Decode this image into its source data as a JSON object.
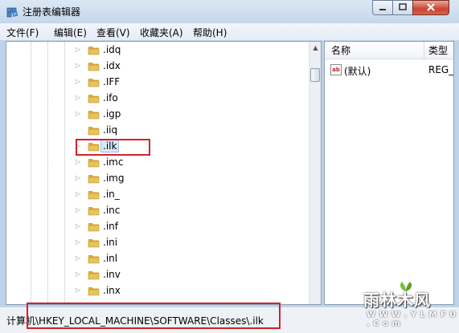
{
  "window": {
    "title": "注册表编辑器",
    "app_icon": "regedit-icon",
    "buttons": {
      "minimize": "─",
      "maximize": "□",
      "close": "✕"
    }
  },
  "menubar": {
    "items": [
      "文件(F)",
      "编辑(E)",
      "查看(V)",
      "收藏夹(A)",
      "帮助(H)"
    ]
  },
  "tree": {
    "items": [
      {
        "label": ".idq",
        "expandable": true
      },
      {
        "label": ".idx",
        "expandable": true
      },
      {
        "label": ".IFF",
        "expandable": true
      },
      {
        "label": ".ifo",
        "expandable": true
      },
      {
        "label": ".igp",
        "expandable": true
      },
      {
        "label": ".iiq",
        "expandable": false
      },
      {
        "label": ".ilk",
        "expandable": true,
        "selected": true
      },
      {
        "label": ".imc",
        "expandable": true
      },
      {
        "label": ".img",
        "expandable": true
      },
      {
        "label": ".in_",
        "expandable": true
      },
      {
        "label": ".inc",
        "expandable": true
      },
      {
        "label": ".inf",
        "expandable": true
      },
      {
        "label": ".ini",
        "expandable": true
      },
      {
        "label": ".inl",
        "expandable": true
      },
      {
        "label": ".inv",
        "expandable": true
      },
      {
        "label": ".inx",
        "expandable": true
      }
    ],
    "selected_index": 6
  },
  "values": {
    "columns": {
      "name": "名称",
      "type": "类型"
    },
    "rows": [
      {
        "name": "(默认)",
        "type": "REG_",
        "icon": "string-value-icon"
      }
    ]
  },
  "statusbar": {
    "path": "计算机\\HKEY_LOCAL_MACHINE\\SOFTWARE\\Classes\\.ilk"
  },
  "watermark": {
    "name": "雨林木风",
    "url": "W W W . Y L M F U . C o m"
  },
  "colors": {
    "highlight_box": "#d2232a",
    "selection": "#d9e8fb",
    "folder": "#e8c35a"
  }
}
